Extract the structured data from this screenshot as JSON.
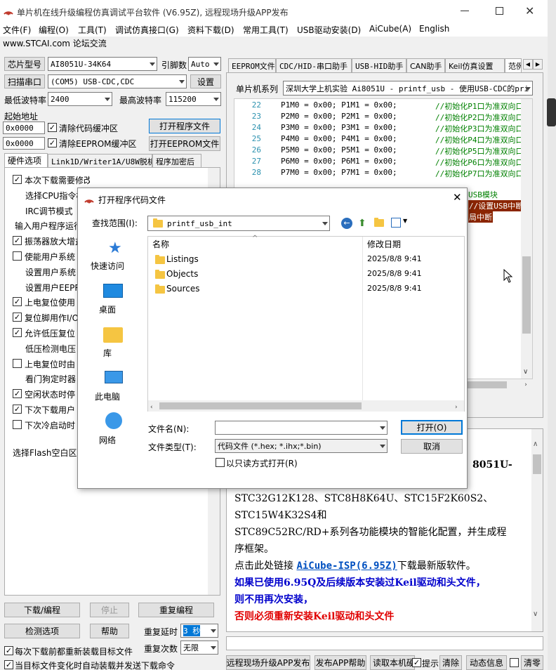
{
  "window": {
    "title": "单片机在线升级编程仿真调试平台软件 (V6.95Z), 远程现场升级APP发布",
    "site": "www.STCAI.com 论坛交流"
  },
  "menu": [
    "文件(F)",
    "编程(O)",
    "工具(T)",
    "调试仿真接口(G)",
    "资料下载(D)",
    "常用工具(T)",
    "USB驱动安装(D)",
    "AiCube(A)",
    "English"
  ],
  "left": {
    "chip_btn": "芯片型号",
    "chip": "AI8051U-34K64",
    "pin_label": "引脚数",
    "pin": "Auto",
    "scan_btn": "扫描串口",
    "port": "(COM5) USB-CDC,CDC",
    "settings_btn": "设置",
    "min_baud_label": "最低波特率",
    "min_baud": "2400",
    "max_baud_label": "最高波特率",
    "max_baud": "115200",
    "start_addr_label": "起始地址",
    "addr1": "0x0000",
    "clear_code": "清除代码缓冲区",
    "open_prog": "打开程序文件",
    "addr2": "0x0000",
    "clear_eeprom": "清除EEPROM缓冲区",
    "open_eeprom": "打开EEPROM文件",
    "tabs": [
      "硬件选项",
      "Link1D/Writer1A/U8W脱机",
      "程序加密后"
    ],
    "options": [
      {
        "text": "本次下载需要修改硬件选项",
        "chk": true
      },
      {
        "text": "选择CPU指令模",
        "chk": null
      },
      {
        "text": "IRC调节模式",
        "chk": null
      },
      {
        "text": "输入用户程序运行",
        "chk": null
      },
      {
        "text": "振荡器放大增益",
        "chk": true
      },
      {
        "text": "使能用户系统",
        "chk": false
      },
      {
        "text": "设置用户系统",
        "chk": null
      },
      {
        "text": "设置用户EEPRO",
        "chk": null
      },
      {
        "text": "上电复位使用",
        "chk": true
      },
      {
        "text": "复位脚用作I/O",
        "chk": true
      },
      {
        "text": "允许低压复位",
        "chk": true
      },
      {
        "text": "低压检测电压",
        "chk": null
      },
      {
        "text": "上电复位时由",
        "chk": false
      },
      {
        "text": "看门狗定时器",
        "chk": null
      },
      {
        "text": "空闲状态时停",
        "chk": true
      },
      {
        "text": "下次下载用户",
        "chk": true
      },
      {
        "text": "下次冷启动时",
        "chk": false
      }
    ],
    "flash_label": "选择Flash空白区",
    "download_btn": "下载/编程",
    "stop_btn": "停止",
    "reprog_btn": "重复编程",
    "detect_btn": "检测选项",
    "help_btn": "帮助",
    "delay_label": "重复延时",
    "delay": "3 秒",
    "count_label": "重复次数",
    "count": "无限",
    "reload_each": "每次下载前都重新装载目标文件",
    "auto_reload": "当目标文件变化时自动装载并发送下载命令"
  },
  "right": {
    "tabs": [
      "EEPROM文件",
      "CDC/HID-串口助手",
      "USB-HID助手",
      "CAN助手",
      "Keil仿真设置",
      "范例"
    ],
    "series_label": "单片机系列",
    "series": "深圳大学上机实验 Ai8051U - printf_usb - 使用USB-CDC的pri",
    "code": [
      {
        "n": "22",
        "src": "P1M0 = 0x00; P1M1 = 0x00;",
        "cm": "//初始化P1口为准双向口"
      },
      {
        "n": "23",
        "src": "P2M0 = 0x00; P2M1 = 0x00;",
        "cm": "//初始化P2口为准双向口"
      },
      {
        "n": "24",
        "src": "P3M0 = 0x00; P3M1 = 0x00;",
        "cm": "//初始化P3口为准双向口"
      },
      {
        "n": "25",
        "src": "P4M0 = 0x00; P4M1 = 0x00;",
        "cm": "//初始化P4口为准双向口"
      },
      {
        "n": "26",
        "src": "P5M0 = 0x00; P5M1 = 0x00;",
        "cm": "//初始化P5口为准双向口"
      },
      {
        "n": "27",
        "src": "P6M0 = 0x00; P6M1 = 0x00;",
        "cm": "//初始化P6口为准双向口"
      },
      {
        "n": "28",
        "src": "P7M0 = 0x00; P7M1 = 0x00;",
        "cm": "//初始化P7口为准双向口"
      }
    ],
    "frag1": "USB模块",
    "frag2": "//设置USB中断",
    "frag3": "局中断",
    "info_frag": "8051U-",
    "info_line1": "STC32G12K128、STC8H8K64U、STC15F2K60S2、",
    "info_line2": "STC15W4K32S4和",
    "info_line3": "STC89C52RC/RD+系列各功能模块的智能化配置，并生成程",
    "info_line4": "序框架。",
    "info_link_pre": "点击此处链接 ",
    "info_link": "AiCube-ISP(6.95Z)",
    "info_link_post": "下载最新版软件。",
    "info_blue1": "如果已使用6.95Q及后续版本安装过Keil驱动和头文件，",
    "info_blue2": "则不用再次安装，",
    "info_red": "否则必须重新安装Keil驱动和头文件",
    "bottom_btns": [
      "远程现场升级APP发布",
      "发布APP帮助",
      "读取本机硬",
      "提示",
      "清除",
      "动态信息",
      "清零"
    ]
  },
  "dialog": {
    "title": "打开程序代码文件",
    "look_in_label": "查找范围(I):",
    "look_in": "printf_usb_int",
    "places": [
      "快速访问",
      "桌面",
      "库",
      "此电脑",
      "网络"
    ],
    "col_name": "名称",
    "col_date": "修改日期",
    "files": [
      {
        "name": "Listings",
        "date": "2025/8/8 9:41"
      },
      {
        "name": "Objects",
        "date": "2025/8/8 9:41"
      },
      {
        "name": "Sources",
        "date": "2025/8/8 9:41"
      }
    ],
    "filename_label": "文件名(N):",
    "filename": "",
    "filetype_label": "文件类型(T):",
    "filetype": "代码文件 (*.hex; *.ihx;*.bin)",
    "readonly": "以只读方式打开(R)",
    "open_btn": "打开(O)",
    "cancel_btn": "取消"
  }
}
